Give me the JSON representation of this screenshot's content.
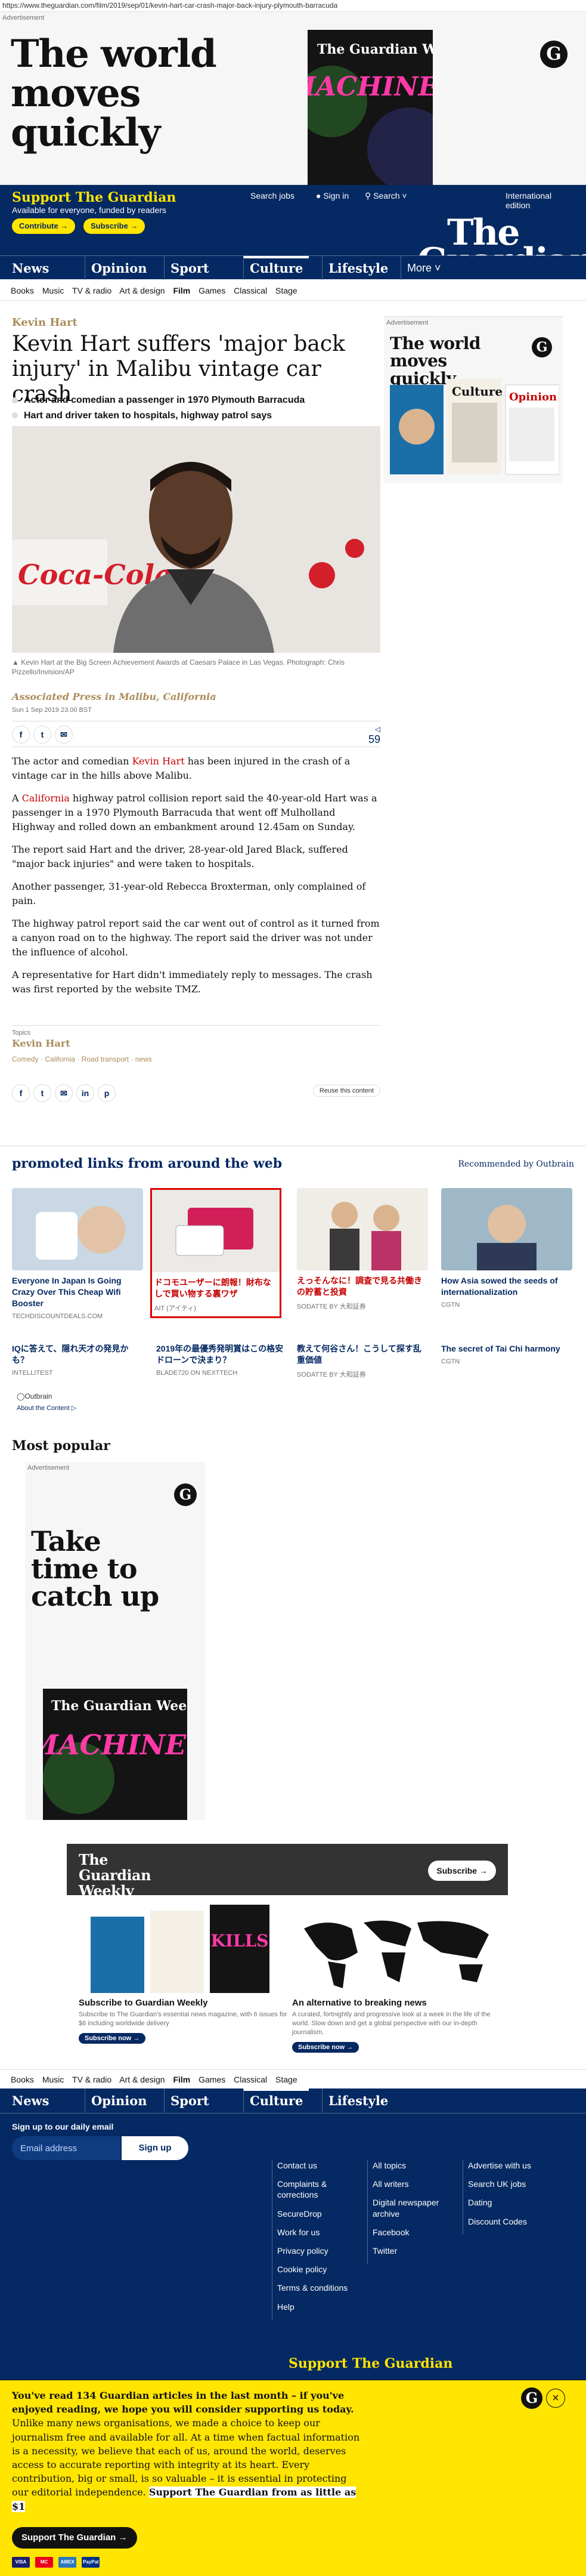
{
  "url": "https://www.theguardian.com/film/2019/sep/01/kevin-hart-car-crash-major-back-injury-plymouth-barracuda",
  "top_ad": {
    "label": "Advertisement",
    "headline": "The world moves quickly",
    "mag_masthead": "The Guardian Weekly",
    "mag_cover": "THIS MACHINE KILLS"
  },
  "masthead": {
    "support_title": "Support The Guardian",
    "support_sub": "Available for everyone, funded by readers",
    "contribute": "Contribute →",
    "subscribe": "Subscribe →",
    "search_jobs": "Search jobs",
    "sign_in": "Sign in",
    "search": "Search",
    "edition": "International edition",
    "wordmark_1": "The",
    "wordmark_2": "Guardian"
  },
  "nav": [
    "News",
    "Opinion",
    "Sport",
    "Culture",
    "Lifestyle",
    "More"
  ],
  "subnav": [
    "Books",
    "Music",
    "TV & radio",
    "Art & design",
    "Film",
    "Games",
    "Classical",
    "Stage"
  ],
  "article": {
    "kicker": "Kevin Hart",
    "title": "Kevin Hart suffers 'major back injury' in Malibu vintage car crash",
    "standfirst": [
      "Actor and comedian a passenger in 1970 Plymouth Barracuda",
      "Hart and driver taken to hospitals, highway patrol says"
    ],
    "image_sign": "Coca-Cola",
    "caption": "Kevin Hart at the Big Screen Achievement Awards at Caesars Palace in Las Vegas. Photograph: Chris Pizzello/Invision/AP",
    "byline": "Associated Press in Malibu, California",
    "date": "Sun 1 Sep 2019 23.00 BST",
    "comment_count": "59",
    "paragraphs": [
      [
        "The actor and comedian ",
        "Kevin Hart",
        " has been injured in the crash of a vintage car in the hills above Malibu."
      ],
      [
        "A ",
        "California",
        " highway patrol collision report said the 40-year-old Hart was a passenger in a 1970 Plymouth Barracuda that went off Mulholland Highway and rolled down an embankment around 12.45am on Sunday."
      ],
      [
        "The report said Hart and the driver, 28-year-old Jared Black, suffered \"major back injuries\" and were taken to hospitals."
      ],
      [
        "Another passenger, 31-year-old Rebecca Broxterman, only complained of pain."
      ],
      [
        "The highway patrol report said the car went out of control as it turned from a canyon road on to the highway. The report said the driver was not under the influence of alcohol."
      ],
      [
        "A representative for Hart didn't immediately reply to messages. The crash was first reported by the website TMZ."
      ]
    ],
    "topics_label": "Topics",
    "topics_main": "Kevin Hart",
    "topics_tags": "Comedy · California · Road transport · news",
    "reuse": "Reuse this content"
  },
  "right_ad": {
    "label": "Advertisement",
    "headline": "The world moves quickly",
    "culture": "Culture",
    "opinion": "Opinion"
  },
  "promoted": {
    "title": "promoted links from around the web",
    "recommended": "Recommended by Outbrain",
    "cards": [
      {
        "headline": "Everyone In Japan Is Going Crazy Over This Cheap Wifi Booster",
        "source": "TECHDISCOUNTDEALS.COM"
      },
      {
        "headline": "ドコモユーザーに朗報！財布なしで買い物する裏ワザ",
        "source": "AIT (アイティ)"
      },
      {
        "headline": "えっそんなに！調査で見る共働きの貯蓄と投資",
        "source": "SODATTE BY 大和証券"
      },
      {
        "headline": "How Asia sowed the seeds of internationalization",
        "source": "CGTN"
      }
    ],
    "row2": [
      {
        "headline": "IQに答えて、隠れ天才の発見かも？",
        "source": "INTELLITEST"
      },
      {
        "headline": "2019年の最優秀発明賞はこの格安ドローンで決まり？",
        "source": "BLADE720 ON NEXTTECH"
      },
      {
        "headline": "教えて何谷さん！こうして探す乱重価値",
        "source": "SODATTE BY 大和証券"
      },
      {
        "headline": "The secret of Tai Chi harmony",
        "source": "CGTN"
      }
    ],
    "outbrain": "Outbrain",
    "about": "About the Content"
  },
  "most_popular": {
    "title": "Most popular",
    "ad_label": "Advertisement",
    "ad_headline": "Take time to catch up",
    "mag_masthead": "The Guardian Weekly",
    "mag_cover": "THIS MACHINE KILLS"
  },
  "weekly": {
    "logo_1": "The",
    "logo_2": "Guardian",
    "logo_3": "Weekly",
    "subscribe": "Subscribe →",
    "card1_title": "Subscribe to Guardian Weekly",
    "card1_desc": "Subscribe to The Guardian's essential news magazine, with 6 issues for $6 including worldwide delivery",
    "card1_btn": "Subscribe now →",
    "card2_title": "An alternative to breaking news",
    "card2_desc": "A curated, fortnightly and progressive look at a week in the life of the world. Slow down and get a global perspective with our in-depth journalism.",
    "card2_btn": "Subscribe now →"
  },
  "footer": {
    "signup_label": "Sign up to our daily email",
    "email_placeholder": "Email address",
    "signup_btn": "Sign up",
    "col1": [
      "Contact us",
      "Complaints & corrections",
      "SecureDrop",
      "Work for us",
      "Privacy policy",
      "Cookie policy",
      "Terms & conditions",
      "Help"
    ],
    "col2": [
      "All topics",
      "All writers",
      "Digital newspaper archive",
      "Facebook",
      "Twitter"
    ],
    "col3": [
      "Advertise with us",
      "Search UK jobs",
      "Dating",
      "Discount Codes"
    ],
    "support": "Support The Guardian"
  },
  "banner": {
    "lead": "You've read 134 Guardian articles in the last month – if you've enjoyed reading, we hope you will consider supporting us today.",
    "body": " Unlike many news organisations, we made a choice to keep our journalism free and available for all. At a time when factual information is a necessity, we believe that each of us, around the world, deserves access to accurate reporting with integrity at its heart. Every contribution, big or small, is so valuable – it is essential in protecting our editorial independence. ",
    "highlight": "Support The Guardian from as little as $1",
    "cta": "Support The Guardian →",
    "cards": [
      "VISA",
      "MC",
      "AMEX",
      "PayPal"
    ]
  }
}
